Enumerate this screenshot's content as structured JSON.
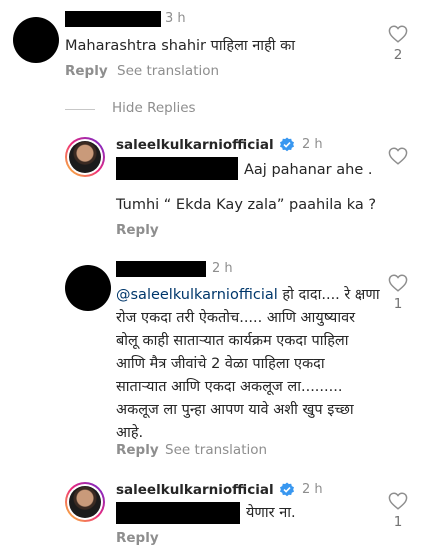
{
  "comment1": {
    "time": "3 h",
    "text": "Maharashtra shahir पाहिला नाही का",
    "reply": "Reply",
    "see_translation": "See translation",
    "likes": "2"
  },
  "hide_replies": "Hide Replies",
  "reply1": {
    "username": "saleelkulkarniofficial",
    "time": "2 h",
    "line1": "Aaj pahanar ahe .",
    "line2": "Tumhi “ Ekda Kay zala” paahila ka ?",
    "reply": "Reply"
  },
  "comment2": {
    "time": "2 h",
    "mention": "@saleelkulkarniofficial",
    "line1_rest": " हो दादा.... रे क्षणा",
    "line2": "रोज एकदा तरी ऐकतोच..... आणि आयुष्यावर",
    "line3": "बोलू काही साताऱ्यात कार्यक्रम एकदा पाहिला",
    "line4": "आणि मैत्र जीवांचे 2 वेळा पाहिला एकदा",
    "line5": "साताऱ्यात आणि एकदा अकलूज ला.........",
    "line6": "अकलूज ला पुन्हा आपण यावे अशी खुप इच्छा",
    "line7": "आहे.",
    "reply": "Reply",
    "see_translation": "See translation",
    "likes": "1"
  },
  "reply2": {
    "username": "saleelkulkarniofficial",
    "time": "2 h",
    "text": "येणार ना.",
    "reply": "Reply",
    "likes": "1"
  },
  "icons": {
    "heart": "heart-outline-icon",
    "verified": "verified-badge-icon"
  },
  "colors": {
    "verified_blue": "#3897f0",
    "mention": "#00376b",
    "muted": "#8e8e8e"
  }
}
